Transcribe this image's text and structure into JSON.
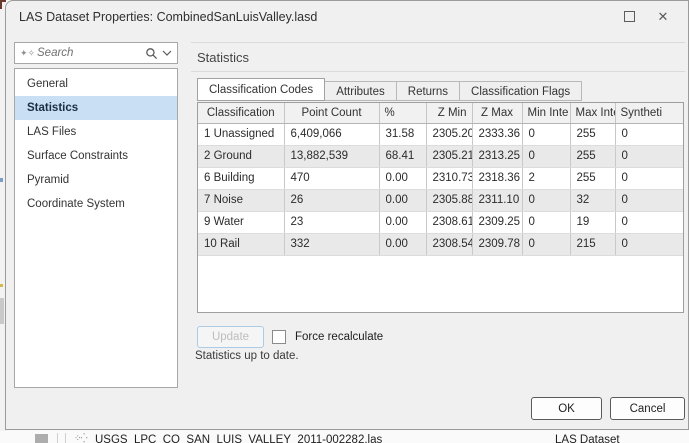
{
  "window": {
    "title": "LAS Dataset Properties: CombinedSanLuisValley.lasd",
    "maximize_glyph": "",
    "close_glyph": "✕"
  },
  "sidebar": {
    "search": {
      "placeholder": "Search"
    },
    "items": [
      {
        "label": "General",
        "selected": false
      },
      {
        "label": "Statistics",
        "selected": true
      },
      {
        "label": "LAS Files",
        "selected": false
      },
      {
        "label": "Surface Constraints",
        "selected": false
      },
      {
        "label": "Pyramid",
        "selected": false
      },
      {
        "label": "Coordinate System",
        "selected": false
      }
    ]
  },
  "content": {
    "heading": "Statistics",
    "tabs": [
      {
        "label": "Classification Codes",
        "active": true
      },
      {
        "label": "Attributes",
        "active": false
      },
      {
        "label": "Returns",
        "active": false
      },
      {
        "label": "Classification Flags",
        "active": false
      }
    ],
    "table": {
      "columns": [
        "Classification",
        "Point Count",
        "%",
        "Z Min",
        "Z Max",
        "Min Inte",
        "Max Inte",
        "Syntheti"
      ],
      "rows": [
        [
          "1  Unassigned",
          "6,409,066",
          "31.58",
          "2305.20",
          "2333.36",
          "0",
          "255",
          "0"
        ],
        [
          "2  Ground",
          "13,882,539",
          "68.41",
          "2305.21",
          "2313.25",
          "0",
          "255",
          "0"
        ],
        [
          "6  Building",
          "470",
          "0.00",
          "2310.73",
          "2318.36",
          "2",
          "255",
          "0"
        ],
        [
          "7  Noise",
          "26",
          "0.00",
          "2305.88",
          "2311.10",
          "0",
          "32",
          "0"
        ],
        [
          "9  Water",
          "23",
          "0.00",
          "2308.61",
          "2309.25",
          "0",
          "19",
          "0"
        ],
        [
          "10  Rail",
          "332",
          "0.00",
          "2308.54",
          "2309.78",
          "0",
          "215",
          "0"
        ]
      ]
    },
    "update_button_label": "Update",
    "force_recalculate_label": "Force recalculate",
    "status_text": "Statistics up to date."
  },
  "footer": {
    "ok_label": "OK",
    "cancel_label": "Cancel"
  },
  "background_window": {
    "file_name": "USGS_LPC_CO_SAN_LUIS_VALLEY_2011-002282.las",
    "type_label": "LAS Dataset"
  },
  "colors": {
    "selection_blue": "#c9e0f4",
    "disabled_accent_border": "#abcbe7",
    "dialog_bg": "#f0f0f0",
    "row_alt_gray": "#e9e9e9"
  }
}
